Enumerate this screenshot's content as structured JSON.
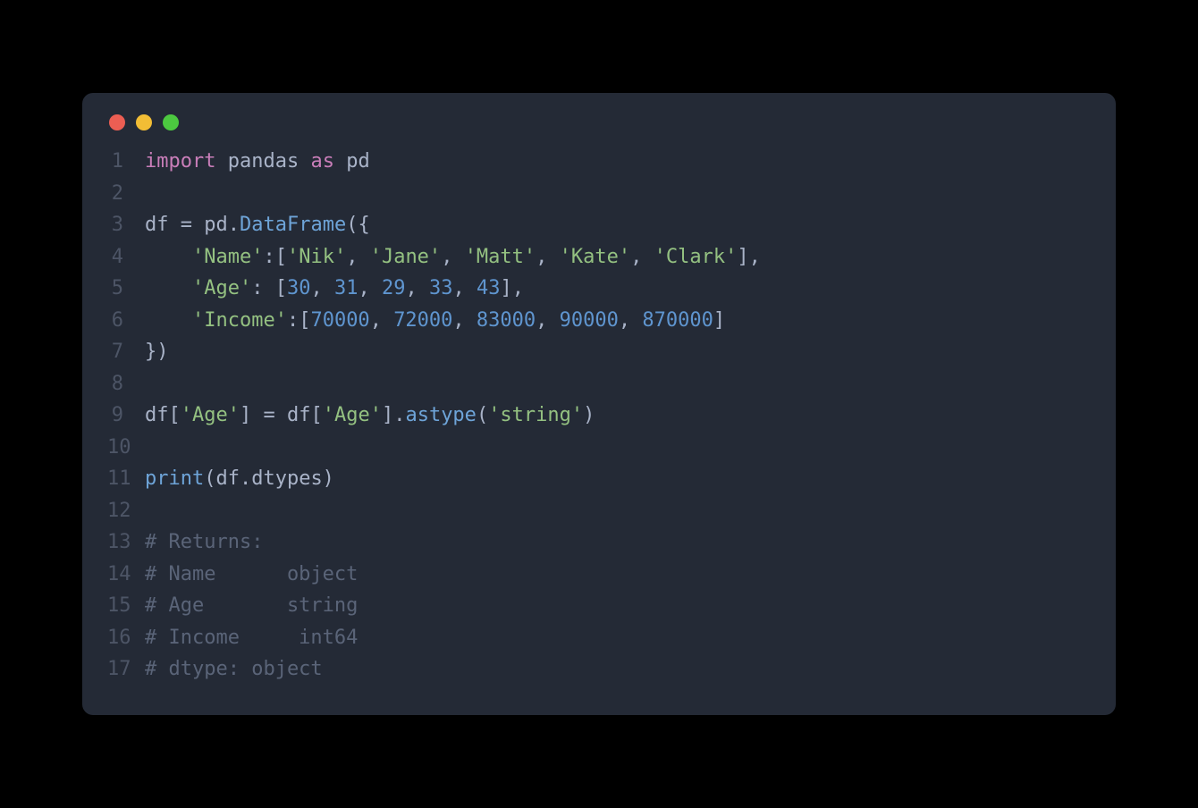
{
  "lines": [
    {
      "num": "1",
      "tokens": [
        {
          "t": "import",
          "c": "tok-keyword"
        },
        {
          "t": " ",
          "c": "tok-default"
        },
        {
          "t": "pandas",
          "c": "tok-module"
        },
        {
          "t": " ",
          "c": "tok-default"
        },
        {
          "t": "as",
          "c": "tok-keyword"
        },
        {
          "t": " ",
          "c": "tok-default"
        },
        {
          "t": "pd",
          "c": "tok-alias"
        }
      ]
    },
    {
      "num": "2",
      "tokens": []
    },
    {
      "num": "3",
      "tokens": [
        {
          "t": "df ",
          "c": "tok-default"
        },
        {
          "t": "=",
          "c": "tok-punc"
        },
        {
          "t": " pd.",
          "c": "tok-default"
        },
        {
          "t": "DataFrame",
          "c": "tok-call"
        },
        {
          "t": "({",
          "c": "tok-punc"
        }
      ]
    },
    {
      "num": "4",
      "tokens": [
        {
          "t": "    ",
          "c": "tok-default"
        },
        {
          "t": "'Name'",
          "c": "tok-string"
        },
        {
          "t": ":[",
          "c": "tok-punc"
        },
        {
          "t": "'Nik'",
          "c": "tok-string"
        },
        {
          "t": ", ",
          "c": "tok-punc"
        },
        {
          "t": "'Jane'",
          "c": "tok-string"
        },
        {
          "t": ", ",
          "c": "tok-punc"
        },
        {
          "t": "'Matt'",
          "c": "tok-string"
        },
        {
          "t": ", ",
          "c": "tok-punc"
        },
        {
          "t": "'Kate'",
          "c": "tok-string"
        },
        {
          "t": ", ",
          "c": "tok-punc"
        },
        {
          "t": "'Clark'",
          "c": "tok-string"
        },
        {
          "t": "],",
          "c": "tok-punc"
        }
      ]
    },
    {
      "num": "5",
      "tokens": [
        {
          "t": "    ",
          "c": "tok-default"
        },
        {
          "t": "'Age'",
          "c": "tok-string"
        },
        {
          "t": ": [",
          "c": "tok-punc"
        },
        {
          "t": "30",
          "c": "tok-number"
        },
        {
          "t": ", ",
          "c": "tok-punc"
        },
        {
          "t": "31",
          "c": "tok-number"
        },
        {
          "t": ", ",
          "c": "tok-punc"
        },
        {
          "t": "29",
          "c": "tok-number"
        },
        {
          "t": ", ",
          "c": "tok-punc"
        },
        {
          "t": "33",
          "c": "tok-number"
        },
        {
          "t": ", ",
          "c": "tok-punc"
        },
        {
          "t": "43",
          "c": "tok-number"
        },
        {
          "t": "],",
          "c": "tok-punc"
        }
      ]
    },
    {
      "num": "6",
      "tokens": [
        {
          "t": "    ",
          "c": "tok-default"
        },
        {
          "t": "'Income'",
          "c": "tok-string"
        },
        {
          "t": ":[",
          "c": "tok-punc"
        },
        {
          "t": "70000",
          "c": "tok-number"
        },
        {
          "t": ", ",
          "c": "tok-punc"
        },
        {
          "t": "72000",
          "c": "tok-number"
        },
        {
          "t": ", ",
          "c": "tok-punc"
        },
        {
          "t": "83000",
          "c": "tok-number"
        },
        {
          "t": ", ",
          "c": "tok-punc"
        },
        {
          "t": "90000",
          "c": "tok-number"
        },
        {
          "t": ", ",
          "c": "tok-punc"
        },
        {
          "t": "870000",
          "c": "tok-number"
        },
        {
          "t": "]",
          "c": "tok-punc"
        }
      ]
    },
    {
      "num": "7",
      "tokens": [
        {
          "t": "})",
          "c": "tok-punc"
        }
      ]
    },
    {
      "num": "8",
      "tokens": []
    },
    {
      "num": "9",
      "tokens": [
        {
          "t": "df[",
          "c": "tok-default"
        },
        {
          "t": "'Age'",
          "c": "tok-string"
        },
        {
          "t": "] ",
          "c": "tok-default"
        },
        {
          "t": "=",
          "c": "tok-punc"
        },
        {
          "t": " df[",
          "c": "tok-default"
        },
        {
          "t": "'Age'",
          "c": "tok-string"
        },
        {
          "t": "].",
          "c": "tok-default"
        },
        {
          "t": "astype",
          "c": "tok-fname"
        },
        {
          "t": "(",
          "c": "tok-punc"
        },
        {
          "t": "'string'",
          "c": "tok-string"
        },
        {
          "t": ")",
          "c": "tok-punc"
        }
      ]
    },
    {
      "num": "10",
      "tokens": []
    },
    {
      "num": "11",
      "tokens": [
        {
          "t": "print",
          "c": "tok-fname"
        },
        {
          "t": "(df.dtypes)",
          "c": "tok-default"
        }
      ]
    },
    {
      "num": "12",
      "tokens": []
    },
    {
      "num": "13",
      "tokens": [
        {
          "t": "# Returns:",
          "c": "tok-comment"
        }
      ]
    },
    {
      "num": "14",
      "tokens": [
        {
          "t": "# Name      object",
          "c": "tok-comment"
        }
      ]
    },
    {
      "num": "15",
      "tokens": [
        {
          "t": "# Age       string",
          "c": "tok-comment"
        }
      ]
    },
    {
      "num": "16",
      "tokens": [
        {
          "t": "# Income     int64",
          "c": "tok-comment"
        }
      ]
    },
    {
      "num": "17",
      "tokens": [
        {
          "t": "# dtype: object",
          "c": "tok-comment"
        }
      ]
    }
  ]
}
